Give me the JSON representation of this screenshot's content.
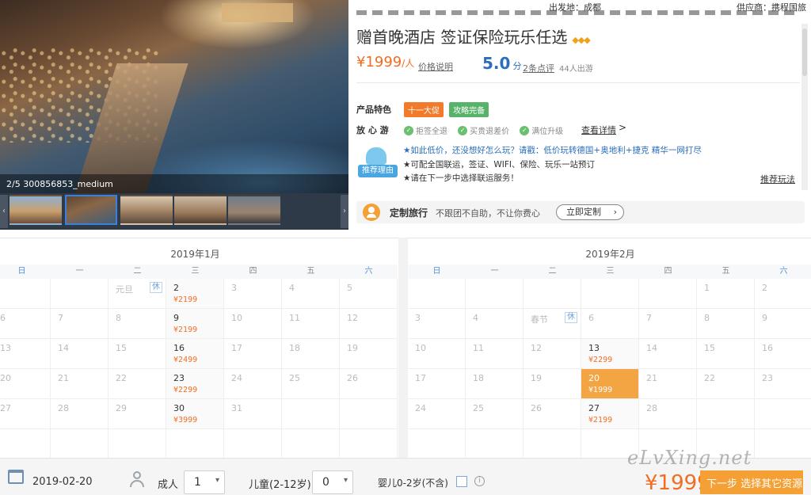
{
  "top": {
    "departure_label": "出发地：成都",
    "supplier_label": "供应商：携程国旅"
  },
  "gallery": {
    "caption": "2/5 300856853_medium",
    "thumb_count": 5,
    "active_thumb": 2
  },
  "product": {
    "title_line2": "赠首晚酒店 签证保险玩乐任选",
    "price": "¥1999",
    "price_unit": "/人",
    "price_note_link": "价格说明",
    "rating": "5.0",
    "rating_unit": "分",
    "reviews_link": "2条点评",
    "travelers": "44人出游",
    "features_label": "产品特色",
    "tags": [
      {
        "label": "十一大促",
        "color": "#f27b2b"
      },
      {
        "label": "攻略完备",
        "color": "#57b36a"
      }
    ],
    "assurance_label": "放 心 游",
    "assurances": [
      "拒签全退",
      "买贵退差价",
      "满位升级"
    ],
    "details_link": "查看详情",
    "recommend_badge": "推荐理由",
    "recommend_lines": [
      "★如此低价，还没想好怎么玩？请戳：低价玩转德国+奥地利+捷克 精华一网打尽",
      "★可配全国联运，签证、WIFI、保险、玩乐一站预订",
      "★请在下一步中选择联运服务！"
    ],
    "recommend_more_link": "推荐玩法",
    "custom_title": "定制旅行",
    "custom_desc": "不跟团不自助，不让你费心",
    "custom_button": "立即定制"
  },
  "calendar": {
    "weekdays": [
      "日",
      "一",
      "二",
      "三",
      "四",
      "五",
      "六"
    ],
    "months": [
      {
        "title": "2019年1月",
        "cells": [
          {
            "row": 0,
            "col": 2,
            "holiday": "元旦",
            "rest": "休"
          },
          {
            "row": 0,
            "col": 3,
            "day": "2",
            "price": "¥2199"
          },
          {
            "row": 0,
            "col": 4,
            "day": "3"
          },
          {
            "row": 0,
            "col": 5,
            "day": "4"
          },
          {
            "row": 0,
            "col": 6,
            "day": "5"
          },
          {
            "row": 1,
            "col": 0,
            "day": "6"
          },
          {
            "row": 1,
            "col": 1,
            "day": "7"
          },
          {
            "row": 1,
            "col": 2,
            "day": "8"
          },
          {
            "row": 1,
            "col": 3,
            "day": "9",
            "price": "¥2199"
          },
          {
            "row": 1,
            "col": 4,
            "day": "10"
          },
          {
            "row": 1,
            "col": 5,
            "day": "11"
          },
          {
            "row": 1,
            "col": 6,
            "day": "12"
          },
          {
            "row": 2,
            "col": 0,
            "day": "13"
          },
          {
            "row": 2,
            "col": 1,
            "day": "14"
          },
          {
            "row": 2,
            "col": 2,
            "day": "15"
          },
          {
            "row": 2,
            "col": 3,
            "day": "16",
            "price": "¥2499"
          },
          {
            "row": 2,
            "col": 4,
            "day": "17"
          },
          {
            "row": 2,
            "col": 5,
            "day": "18"
          },
          {
            "row": 2,
            "col": 6,
            "day": "19"
          },
          {
            "row": 3,
            "col": 0,
            "day": "20"
          },
          {
            "row": 3,
            "col": 1,
            "day": "21"
          },
          {
            "row": 3,
            "col": 2,
            "day": "22"
          },
          {
            "row": 3,
            "col": 3,
            "day": "23",
            "price": "¥2299"
          },
          {
            "row": 3,
            "col": 4,
            "day": "24"
          },
          {
            "row": 3,
            "col": 5,
            "day": "25"
          },
          {
            "row": 3,
            "col": 6,
            "day": "26"
          },
          {
            "row": 4,
            "col": 0,
            "day": "27"
          },
          {
            "row": 4,
            "col": 1,
            "day": "28"
          },
          {
            "row": 4,
            "col": 2,
            "day": "29"
          },
          {
            "row": 4,
            "col": 3,
            "day": "30",
            "price": "¥3999"
          },
          {
            "row": 4,
            "col": 4,
            "day": "31"
          }
        ]
      },
      {
        "title": "2019年2月",
        "cells": [
          {
            "row": 0,
            "col": 5,
            "day": "1"
          },
          {
            "row": 0,
            "col": 6,
            "day": "2"
          },
          {
            "row": 1,
            "col": 0,
            "day": "3"
          },
          {
            "row": 1,
            "col": 1,
            "day": "4"
          },
          {
            "row": 1,
            "col": 2,
            "holiday": "春节",
            "rest": "休"
          },
          {
            "row": 1,
            "col": 3,
            "day": "6"
          },
          {
            "row": 1,
            "col": 4,
            "day": "7"
          },
          {
            "row": 1,
            "col": 5,
            "day": "8"
          },
          {
            "row": 1,
            "col": 6,
            "day": "9"
          },
          {
            "row": 2,
            "col": 0,
            "day": "10"
          },
          {
            "row": 2,
            "col": 1,
            "day": "11"
          },
          {
            "row": 2,
            "col": 2,
            "day": "12"
          },
          {
            "row": 2,
            "col": 3,
            "day": "13",
            "price": "¥2299"
          },
          {
            "row": 2,
            "col": 4,
            "day": "14"
          },
          {
            "row": 2,
            "col": 5,
            "day": "15"
          },
          {
            "row": 2,
            "col": 6,
            "day": "16"
          },
          {
            "row": 3,
            "col": 0,
            "day": "17"
          },
          {
            "row": 3,
            "col": 1,
            "day": "18"
          },
          {
            "row": 3,
            "col": 2,
            "day": "19"
          },
          {
            "row": 3,
            "col": 3,
            "day": "20",
            "price": "¥1999",
            "selected": true
          },
          {
            "row": 3,
            "col": 4,
            "day": "21"
          },
          {
            "row": 3,
            "col": 5,
            "day": "22"
          },
          {
            "row": 3,
            "col": 6,
            "day": "23"
          },
          {
            "row": 4,
            "col": 0,
            "day": "24"
          },
          {
            "row": 4,
            "col": 1,
            "day": "25"
          },
          {
            "row": 4,
            "col": 2,
            "day": "26"
          },
          {
            "row": 4,
            "col": 3,
            "day": "27",
            "price": "¥2199"
          },
          {
            "row": 4,
            "col": 4,
            "day": "28"
          }
        ]
      }
    ]
  },
  "booking": {
    "date": "2019-02-20",
    "adult_label": "成人",
    "adult_value": "1",
    "child_label": "儿童(2-12岁)",
    "child_value": "0",
    "infant_label": "婴儿0-2岁(不含)",
    "total_price": "¥1999",
    "next_button": "下一步 选择其它资源",
    "watermark": "eLvXing.net"
  }
}
